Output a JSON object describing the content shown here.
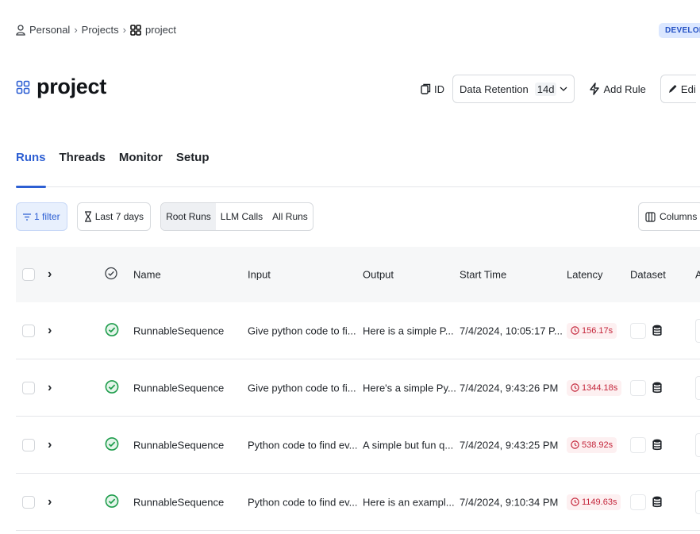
{
  "breadcrumb": {
    "personal": "Personal",
    "projects": "Projects",
    "project": "project"
  },
  "env_badge": "DEVELOPE",
  "page_title": "project",
  "actions": {
    "id_label": "ID",
    "retention_label": "Data Retention",
    "retention_value": "14d",
    "add_rule": "Add Rule",
    "edit": "Edi"
  },
  "tabs": [
    {
      "label": "Runs",
      "active": true
    },
    {
      "label": "Threads",
      "active": false
    },
    {
      "label": "Monitor",
      "active": false
    },
    {
      "label": "Setup",
      "active": false
    }
  ],
  "filters": {
    "filter_count": "1 filter",
    "date_range": "Last 7 days",
    "run_types": [
      {
        "label": "Root Runs",
        "selected": true
      },
      {
        "label": "LLM Calls",
        "selected": false
      },
      {
        "label": "All Runs",
        "selected": false
      }
    ],
    "columns": "Columns"
  },
  "table": {
    "headers": {
      "name": "Name",
      "input": "Input",
      "output": "Output",
      "start_time": "Start Time",
      "latency": "Latency",
      "dataset": "Dataset",
      "last": "A"
    },
    "rows": [
      {
        "name": "RunnableSequence",
        "input": "Give python code to fi...",
        "output": "Here is a simple P...",
        "start_time": "7/4/2024, 10:05:17 P...",
        "latency": "156.17s",
        "status": "success"
      },
      {
        "name": "RunnableSequence",
        "input": "Give python code to fi...",
        "output": "Here's a simple Py...",
        "start_time": "7/4/2024, 9:43:26 PM",
        "latency": "1344.18s",
        "status": "success"
      },
      {
        "name": "RunnableSequence",
        "input": "Python code to find ev...",
        "output": "A simple but fun q...",
        "start_time": "7/4/2024, 9:43:25 PM",
        "latency": "538.92s",
        "status": "success"
      },
      {
        "name": "RunnableSequence",
        "input": "Python code to find ev...",
        "output": "Here is an exampl...",
        "start_time": "7/4/2024, 9:10:34 PM",
        "latency": "1149.63s",
        "status": "success"
      }
    ]
  },
  "colors": {
    "accent": "#2d5fd3",
    "success": "#1f9d4c",
    "latency_text": "#c4253a",
    "latency_bg": "#fdf0f1"
  }
}
